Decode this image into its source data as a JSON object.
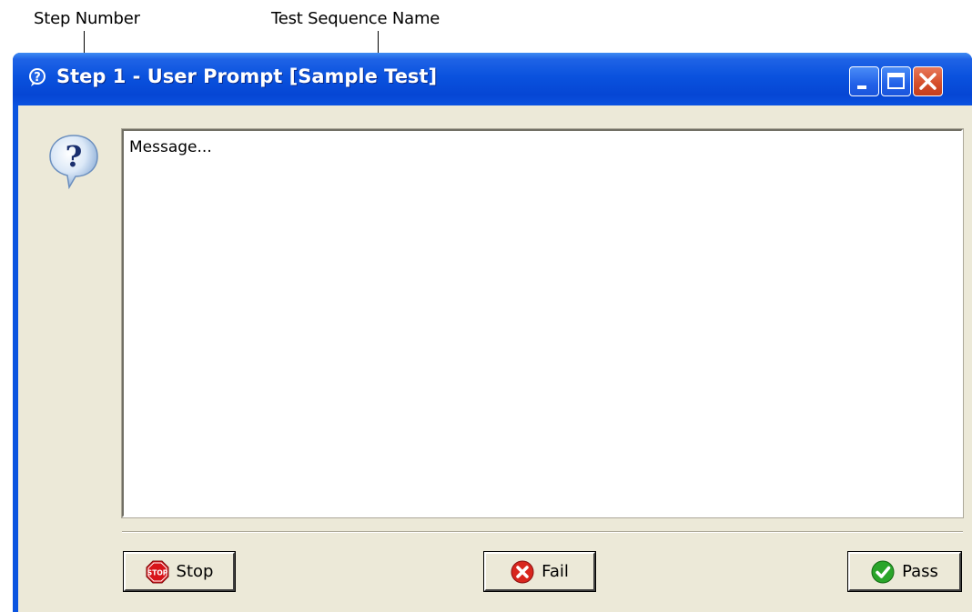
{
  "annotations": {
    "step_number": "Step Number",
    "test_sequence_name": "Test Sequence Name"
  },
  "window": {
    "title": "Step 1 - User Prompt [Sample Test]",
    "title_icon": "question-icon",
    "controls": [
      "minimize",
      "maximize",
      "close"
    ]
  },
  "content": {
    "message": "Message...",
    "prompt_icon": "question-bubble-icon"
  },
  "buttons": {
    "stop": {
      "label": "Stop",
      "icon": "stop-sign-icon",
      "icon_text": "STOP"
    },
    "fail": {
      "label": "Fail",
      "icon": "red-x-icon"
    },
    "pass": {
      "label": "Pass",
      "icon": "green-check-icon"
    }
  },
  "colors": {
    "titlebar": "#0a52de",
    "client_bg": "#ece9d8",
    "close_button": "#d6502c"
  }
}
